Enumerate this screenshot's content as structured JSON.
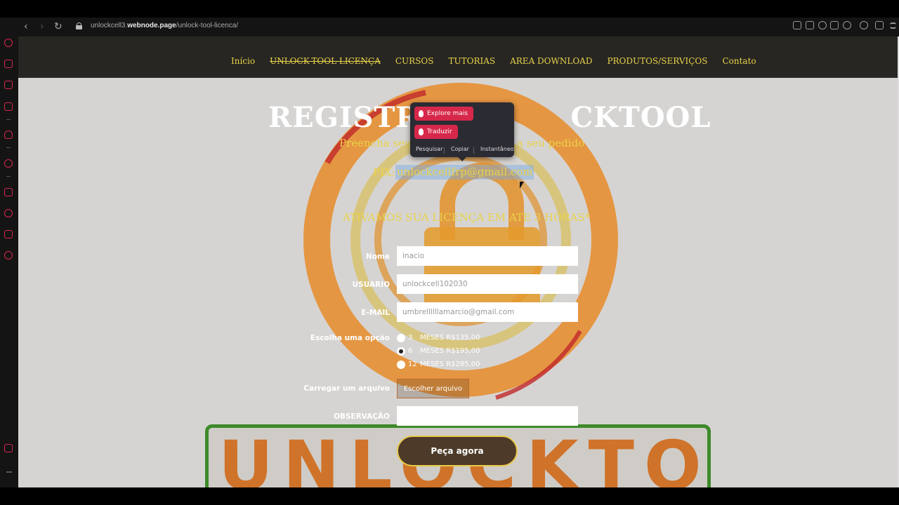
{
  "browser": {
    "url_prefix": "unlockcell3.",
    "url_domain": "webnode.page",
    "url_path": "/unlock-tool-licenca/",
    "back_icon": "‹",
    "forward_icon": "›",
    "reload_icon": "↻"
  },
  "nav": {
    "items": [
      "Início",
      "UNLOCK-TOOL LICENÇA",
      "CURSOS",
      "TUTORIAS",
      "AREA DOWNLOAD",
      "PRODUTOS/SERVIÇOS",
      "Contato"
    ]
  },
  "hero": {
    "title_left": "REGISTRO",
    "title_right": "CKTOOL",
    "subtitle_left": "Preencha  seu",
    "subtitle_right": "a seu pedido",
    "pix_label": "PIX:",
    "pix_email": "unlockcellfrp@gmail.com",
    "notice": "ATIVAMOS SUA LICENÇA EM ATE  3 HORAS*"
  },
  "popup": {
    "explore": "Explore mais",
    "translate": "Traduzir",
    "search": "Pesquisar",
    "copy": "Copiar",
    "instant": "Instantâneo"
  },
  "form": {
    "name_label": "Nome",
    "name_value": "inacio",
    "user_label": "USUARIO",
    "user_value": "unlockcell102030",
    "email_label": "E-MAIL",
    "email_value": "umbrellllllamarcio@gmail.com",
    "option_label": "Escolha uma opção",
    "options": [
      {
        "num": "3",
        "text": "MESES R$135,00",
        "checked": false
      },
      {
        "num": "6",
        "text": "MESES R$195,00",
        "checked": true
      },
      {
        "num": "12",
        "text": "MESES R$285,00",
        "checked": false
      }
    ],
    "file_label": "Carregar um arquivo",
    "file_button": "Escolher arquivo",
    "note_label": "OBSERVAÇÃO",
    "note_value": "",
    "submit": "Peça agora"
  },
  "banner_text": "UNLOCKTOOL",
  "colors": {
    "nav_bg": "#272622",
    "accent_yellow": "#e8d24a",
    "brand_pink": "#d6284a",
    "button_border": "#e8c94a"
  }
}
